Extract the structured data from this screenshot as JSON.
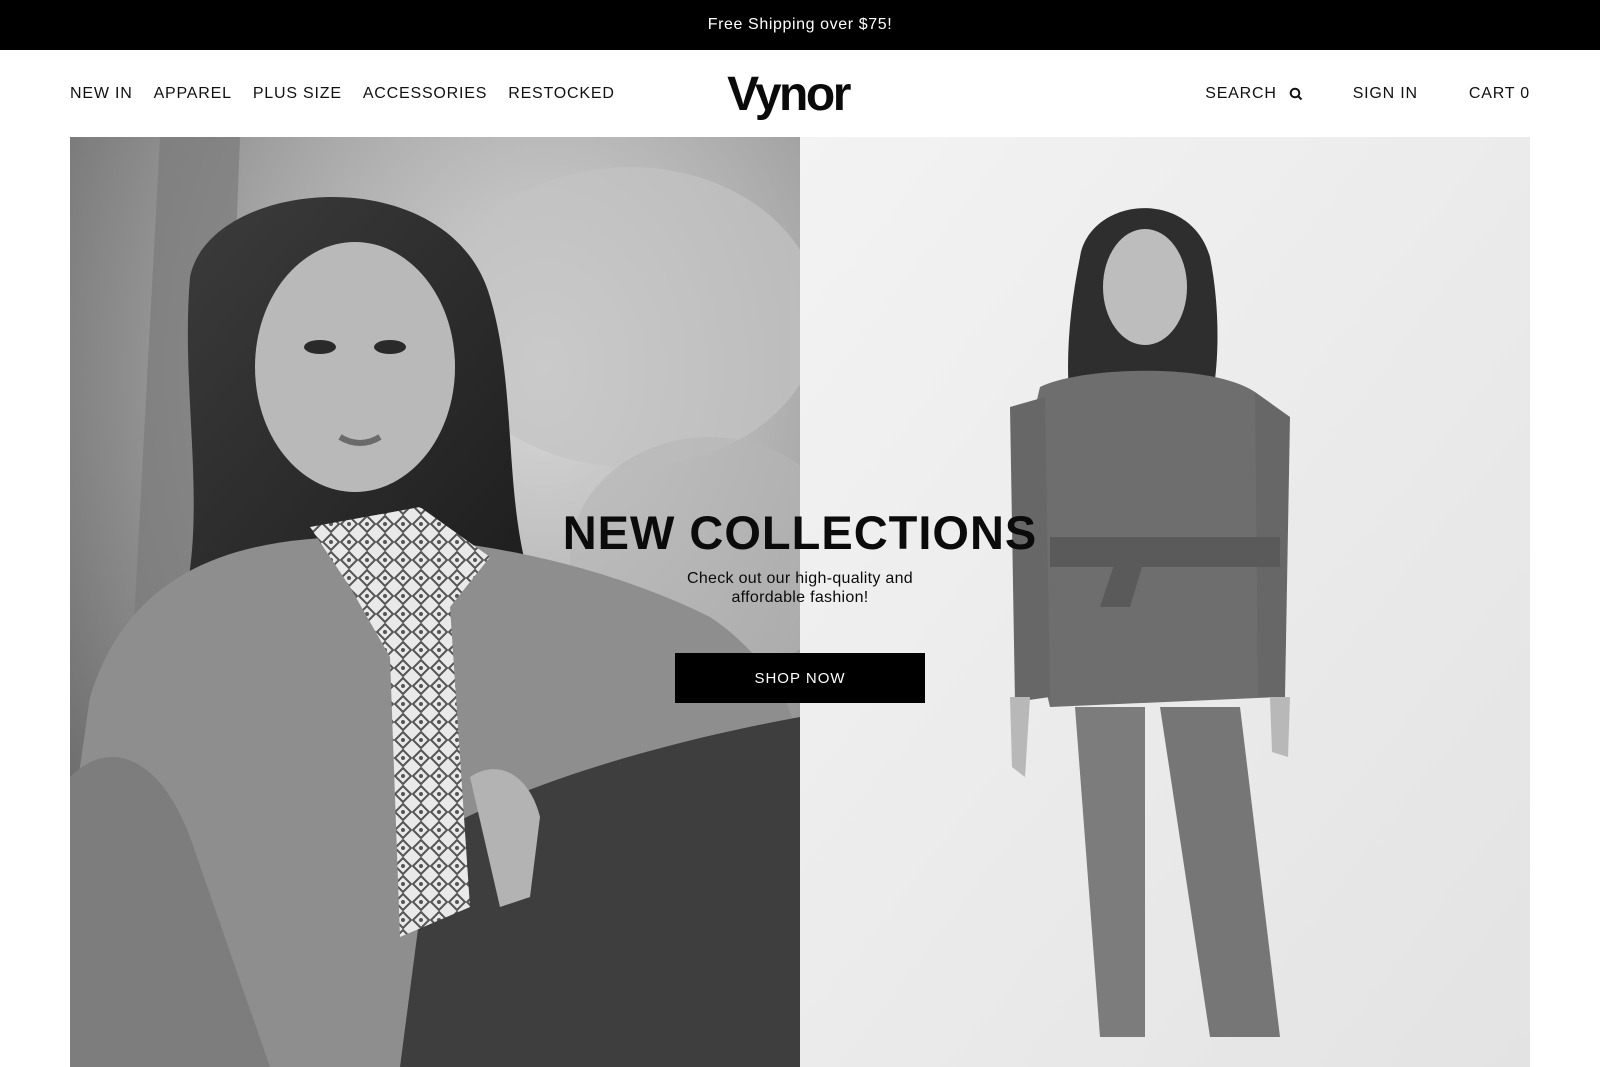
{
  "announcement": {
    "text": "Free Shipping over $75!"
  },
  "header": {
    "logo": "Vynor",
    "nav_left": [
      {
        "label": "NEW IN"
      },
      {
        "label": "APPAREL"
      },
      {
        "label": "PLUS SIZE"
      },
      {
        "label": "ACCESSORIES"
      },
      {
        "label": "RESTOCKED"
      }
    ],
    "search_label": "SEARCH",
    "search_icon": "search-icon",
    "signin_label": "SIGN IN",
    "cart_label": "CART 0"
  },
  "hero": {
    "title": "NEW COLLECTIONS",
    "subtitle": "Check out our high-quality and affordable fashion!",
    "cta_label": "SHOP NOW"
  },
  "colors": {
    "announcement_bg": "#000000",
    "button_bg": "#000000",
    "text": "#111111"
  }
}
